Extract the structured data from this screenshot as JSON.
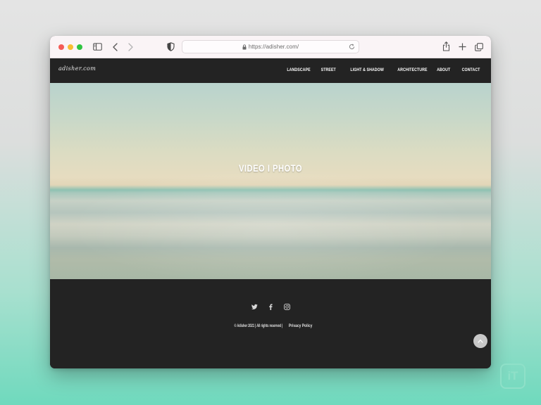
{
  "browser": {
    "url": "https://adisher.com/",
    "icons": {
      "close": "close-dot",
      "minimize": "minimize-dot",
      "zoom": "zoom-dot",
      "sidebar": "sidebar-icon",
      "back": "chevron-left-icon",
      "forward": "chevron-right-icon",
      "privacy": "shield-icon",
      "lock": "lock-icon",
      "reload": "reload-icon",
      "share": "share-icon",
      "new_tab": "plus-icon",
      "tabs": "tabs-overview-icon"
    },
    "colors": {
      "close": "#f45b56",
      "minimize": "#f7bd32",
      "zoom": "#2fc441"
    }
  },
  "site": {
    "logo": "adisher.com",
    "nav": [
      "LANDSCAPE",
      "STREET",
      "LIGHT & SHADOW",
      "ARCHITECTURE",
      "ABOUT",
      "CONTACT"
    ],
    "hero_title": "VIDEO I PHOTO",
    "footer": {
      "socials": [
        "twitter-icon",
        "facebook-icon",
        "instagram-icon"
      ],
      "copyright": "© Adisher 2021 | All rights reserved | ",
      "privacy_link": "Privacy Policy"
    },
    "back_to_top": "chevron-up-icon"
  },
  "badge": {
    "text": "iT",
    "color": "#8fe0c8"
  }
}
